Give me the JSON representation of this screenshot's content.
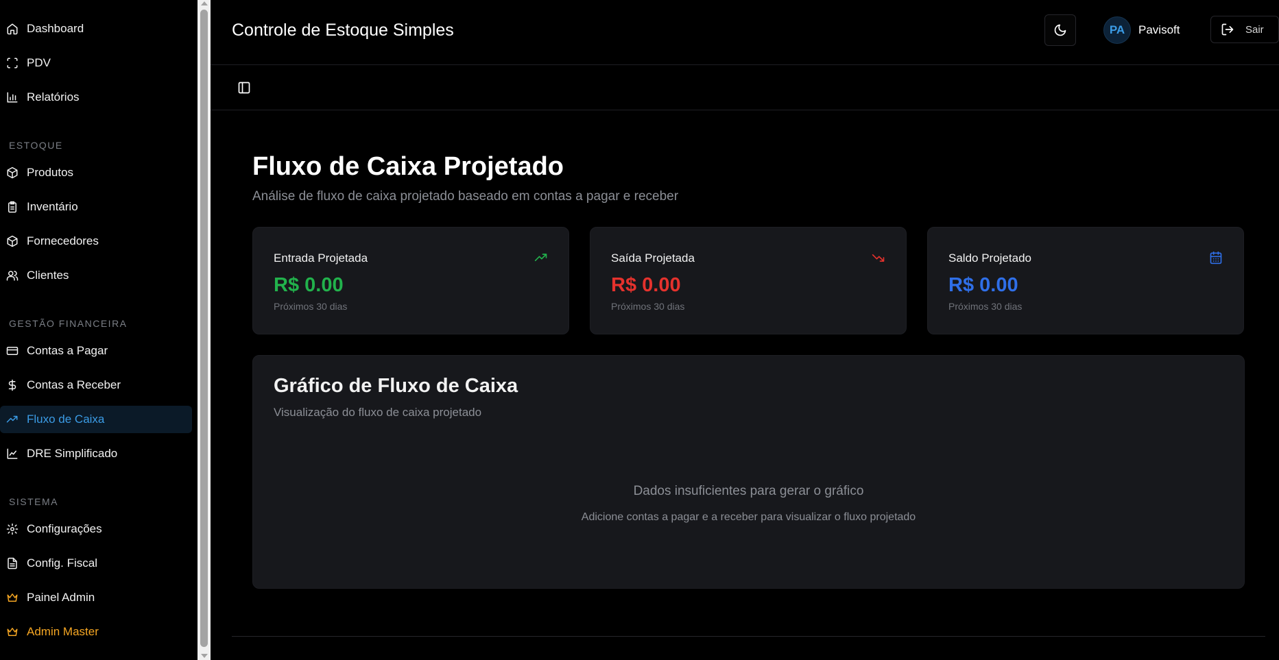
{
  "sidebar": {
    "items": [
      {
        "label": "Dashboard",
        "icon": "home-icon"
      },
      {
        "label": "PDV",
        "icon": "scan-icon"
      },
      {
        "label": "Relatórios",
        "icon": "bar-chart-icon"
      }
    ],
    "sections": [
      {
        "label": "ESTOQUE",
        "items": [
          {
            "label": "Produtos",
            "icon": "package-icon"
          },
          {
            "label": "Inventário",
            "icon": "clipboard-icon"
          },
          {
            "label": "Fornecedores",
            "icon": "package-icon"
          },
          {
            "label": "Clientes",
            "icon": "users-icon"
          }
        ]
      },
      {
        "label": "GESTÃO FINANCEIRA",
        "items": [
          {
            "label": "Contas a Pagar",
            "icon": "credit-card-icon"
          },
          {
            "label": "Contas a Receber",
            "icon": "dollar-icon"
          },
          {
            "label": "Fluxo de Caixa",
            "icon": "trending-up-icon",
            "active": true
          },
          {
            "label": "DRE Simplificado",
            "icon": "line-chart-icon"
          }
        ]
      },
      {
        "label": "SISTEMA",
        "items": [
          {
            "label": "Configurações",
            "icon": "gear-icon"
          },
          {
            "label": "Config. Fiscal",
            "icon": "file-text-icon"
          },
          {
            "label": "Painel Admin",
            "icon": "crown-icon"
          },
          {
            "label": "Admin Master",
            "icon": "crown-icon"
          }
        ]
      }
    ]
  },
  "header": {
    "title": "Controle de Estoque Simples",
    "theme_icon": "moon-icon",
    "user_initials": "PA",
    "user_name": "Pavisoft",
    "logout_label": "Sair"
  },
  "page": {
    "title": "Fluxo de Caixa Projetado",
    "subtitle": "Análise de fluxo de caixa projetado baseado em contas a pagar e receber"
  },
  "cards": [
    {
      "label": "Entrada Projetada",
      "value": "R$ 0.00",
      "note": "Próximos 30 dias",
      "icon": "trending-up-icon",
      "color": "#22b24c"
    },
    {
      "label": "Saída Projetada",
      "value": "R$ 0.00",
      "note": "Próximos 30 dias",
      "icon": "trending-down-icon",
      "color": "#e5322d"
    },
    {
      "label": "Saldo Projetado",
      "value": "R$ 0.00",
      "note": "Próximos 30 dias",
      "icon": "calendar-icon",
      "color": "#2f6fe8"
    }
  ],
  "chart": {
    "title": "Gráfico de Fluxo de Caixa",
    "subtitle": "Visualização do fluxo de caixa projetado",
    "empty_title": "Dados insuficientes para gerar o gráfico",
    "empty_text": "Adicione contas a pagar e a receber para visualizar o fluxo projetado"
  },
  "colors": {
    "accent": "#3b9ce6",
    "active_bg": "#0b1a28",
    "admin_gold": "#f5a623",
    "card_bg": "#17181c"
  }
}
